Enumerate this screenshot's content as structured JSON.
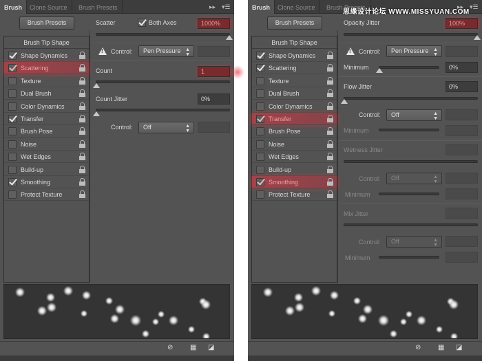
{
  "tabs": [
    "Brush",
    "Clone Source",
    "Brush Presets"
  ],
  "brush_presets_button": "Brush Presets",
  "list_header": "Brush Tip Shape",
  "watermark": "思缘设计论坛 WWW.MISSYUAN.COM",
  "accent_color": "#c0404a",
  "panels": [
    {
      "items": [
        {
          "label": "Shape Dynamics",
          "checked": true,
          "highlighted": false
        },
        {
          "label": "Scattering",
          "checked": true,
          "highlighted": true
        },
        {
          "label": "Texture",
          "checked": false,
          "highlighted": false
        },
        {
          "label": "Dual Brush",
          "checked": false,
          "highlighted": false
        },
        {
          "label": "Color Dynamics",
          "checked": false,
          "highlighted": false
        },
        {
          "label": "Transfer",
          "checked": true,
          "highlighted": false
        },
        {
          "label": "Brush Pose",
          "checked": false,
          "highlighted": false
        },
        {
          "label": "Noise",
          "checked": false,
          "highlighted": false
        },
        {
          "label": "Wet Edges",
          "checked": false,
          "highlighted": false
        },
        {
          "label": "Build-up",
          "checked": false,
          "highlighted": false
        },
        {
          "label": "Smoothing",
          "checked": true,
          "highlighted": false
        },
        {
          "label": "Protect Texture",
          "checked": false,
          "highlighted": false
        }
      ],
      "scatter": {
        "label": "Scatter",
        "both_axes_label": "Both Axes",
        "both_axes_checked": true,
        "value": "1000%",
        "slider_percent": 100
      },
      "control1": {
        "label": "Control:",
        "value": "Pen Pressure"
      },
      "count": {
        "label": "Count",
        "value": "1",
        "slider_percent": 0
      },
      "count_jitter": {
        "label": "Count Jitter",
        "value": "0%",
        "slider_percent": 0
      },
      "control2": {
        "label": "Control:",
        "value": "Off"
      }
    },
    {
      "items": [
        {
          "label": "Shape Dynamics",
          "checked": true,
          "highlighted": false
        },
        {
          "label": "Scattering",
          "checked": true,
          "highlighted": false
        },
        {
          "label": "Texture",
          "checked": false,
          "highlighted": false
        },
        {
          "label": "Dual Brush",
          "checked": false,
          "highlighted": false
        },
        {
          "label": "Color Dynamics",
          "checked": false,
          "highlighted": false
        },
        {
          "label": "Transfer",
          "checked": true,
          "highlighted": true
        },
        {
          "label": "Brush Pose",
          "checked": false,
          "highlighted": false
        },
        {
          "label": "Noise",
          "checked": false,
          "highlighted": false
        },
        {
          "label": "Wet Edges",
          "checked": false,
          "highlighted": false
        },
        {
          "label": "Build-up",
          "checked": false,
          "highlighted": false
        },
        {
          "label": "Smoothing",
          "checked": true,
          "highlighted": true
        },
        {
          "label": "Protect Texture",
          "checked": false,
          "highlighted": false
        }
      ],
      "opacity_jitter": {
        "label": "Opacity Jitter",
        "value": "100%",
        "slider_percent": 100
      },
      "control1": {
        "label": "Control:",
        "value": "Pen Pressure"
      },
      "minimum1": {
        "label": "Minimum",
        "value": "0%"
      },
      "flow_jitter": {
        "label": "Flow Jitter",
        "value": "0%"
      },
      "control2": {
        "label": "Control:",
        "value": "Off"
      },
      "minimum2": {
        "label": "Minimum"
      },
      "wetness_jitter": {
        "label": "Wetness Jitter"
      },
      "control3": {
        "label": "Control:",
        "value": "Off"
      },
      "minimum3": {
        "label": "Minimum"
      },
      "mix_jitter": {
        "label": "Mix Jitter"
      },
      "control4": {
        "label": "Control:",
        "value": "Off"
      },
      "minimum4": {
        "label": "Minimum"
      }
    }
  ]
}
